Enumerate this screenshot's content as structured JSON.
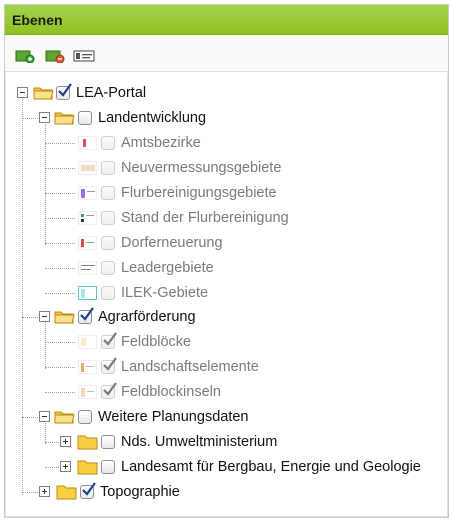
{
  "panel": {
    "title": "Ebenen",
    "toolbar": {
      "add_layer_icon": "add-layer-icon",
      "remove_layer_icon": "remove-layer-icon",
      "layer_properties_icon": "layer-properties-icon"
    }
  },
  "tree": {
    "root": {
      "label": "LEA-Portal",
      "checked": true,
      "expanded": true
    },
    "groups": [
      {
        "label": "Landentwicklung",
        "checked": false,
        "expanded": true,
        "items": [
          {
            "label": "Amtsbezirke",
            "checked": false,
            "legend_color": "#e05050"
          },
          {
            "label": "Neuvermessungsgebiete",
            "checked": false,
            "legend_color": "#d98c3a"
          },
          {
            "label": "Flurbereinigungsgebiete",
            "checked": false,
            "legend_color": "#9a6fd6"
          },
          {
            "label": "Stand der Flurbereinigung",
            "checked": false,
            "legend_color": "#4a9a4a"
          },
          {
            "label": "Dorferneuerung",
            "checked": false,
            "legend_color": "#d64a4a"
          },
          {
            "label": "Leadergebiete",
            "checked": false,
            "legend_color": "#7d7d7d"
          },
          {
            "label": "ILEK-Gebiete",
            "checked": false,
            "legend_color": "#5fc4d6"
          }
        ]
      },
      {
        "label": "Agrarförderung",
        "checked": true,
        "expanded": true,
        "items": [
          {
            "label": "Feldblöcke",
            "checked": true,
            "legend_color": "#e9d59a"
          },
          {
            "label": "Landschaftselemente",
            "checked": true,
            "legend_color": "#d9b06a"
          },
          {
            "label": "Feldblockinseln",
            "checked": true,
            "legend_color": "#d9a06a"
          }
        ]
      },
      {
        "label": "Weitere Planungsdaten",
        "checked": false,
        "expanded": true,
        "subgroups": [
          {
            "label": "Nds. Umweltministerium",
            "checked": false,
            "expanded": false
          },
          {
            "label": "Landesamt für Bergbau, Energie und Geologie",
            "checked": false,
            "expanded": false
          }
        ]
      },
      {
        "label": "Topographie",
        "checked": true,
        "expanded": false
      }
    ]
  },
  "colors": {
    "header_green": "#8dc21f",
    "folder_yellow": "#f5cf4a",
    "checkbox_border": "#8e8e8e",
    "check_mark": "#2d2d2d",
    "disabled_text": "#7a7a7a"
  }
}
